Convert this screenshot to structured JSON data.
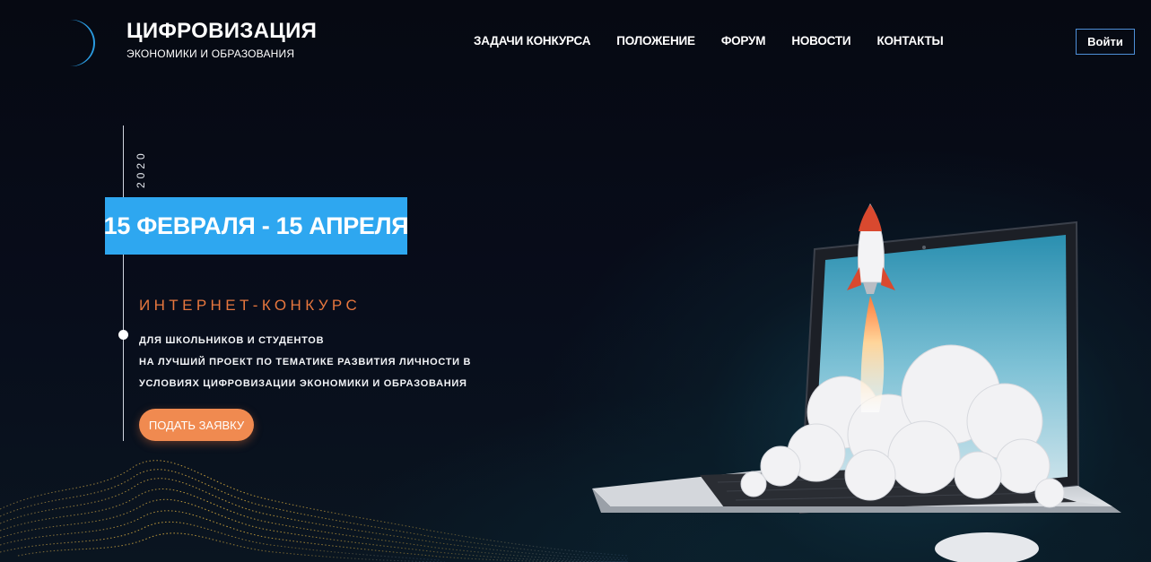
{
  "brand": {
    "title": "ЦИФРОВИЗАЦИЯ",
    "subtitle": "ЭКОНОМИКИ И ОБРАЗОВАНИЯ"
  },
  "nav": {
    "items": [
      {
        "label": "ЗАДАЧИ КОНКУРСА"
      },
      {
        "label": "ПОЛОЖЕНИЕ"
      },
      {
        "label": "ФОРУМ"
      },
      {
        "label": "НОВОСТИ"
      },
      {
        "label": "КОНТАКТЫ"
      }
    ],
    "login_label": "Войти"
  },
  "hero": {
    "year": "2020",
    "dates": "15 ФЕВРАЛЯ - 15 АПРЕЛЯ",
    "contest_label": "ИНТЕРНЕТ-КОНКУРС",
    "description_lines": [
      "ДЛЯ ШКОЛЬНИКОВ И СТУДЕНТОВ",
      "НА ЛУЧШИЙ ПРОЕКТ ПО ТЕМАТИКЕ РАЗВИТИЯ ЛИЧНОСТИ В",
      "УСЛОВИЯХ ЦИФРОВИЗАЦИИ ЭКОНОМИКИ И ОБРАЗОВАНИЯ"
    ],
    "apply_label": "ПОДАТЬ ЗАЯВКУ",
    "illustration": "rocket-launching-from-laptop-image"
  },
  "colors": {
    "background": "#070b16",
    "accent_blue": "#2ea7f0",
    "accent_orange": "#f08a50",
    "contest_label": "#e8773e",
    "login_border": "#4e8fd8"
  }
}
